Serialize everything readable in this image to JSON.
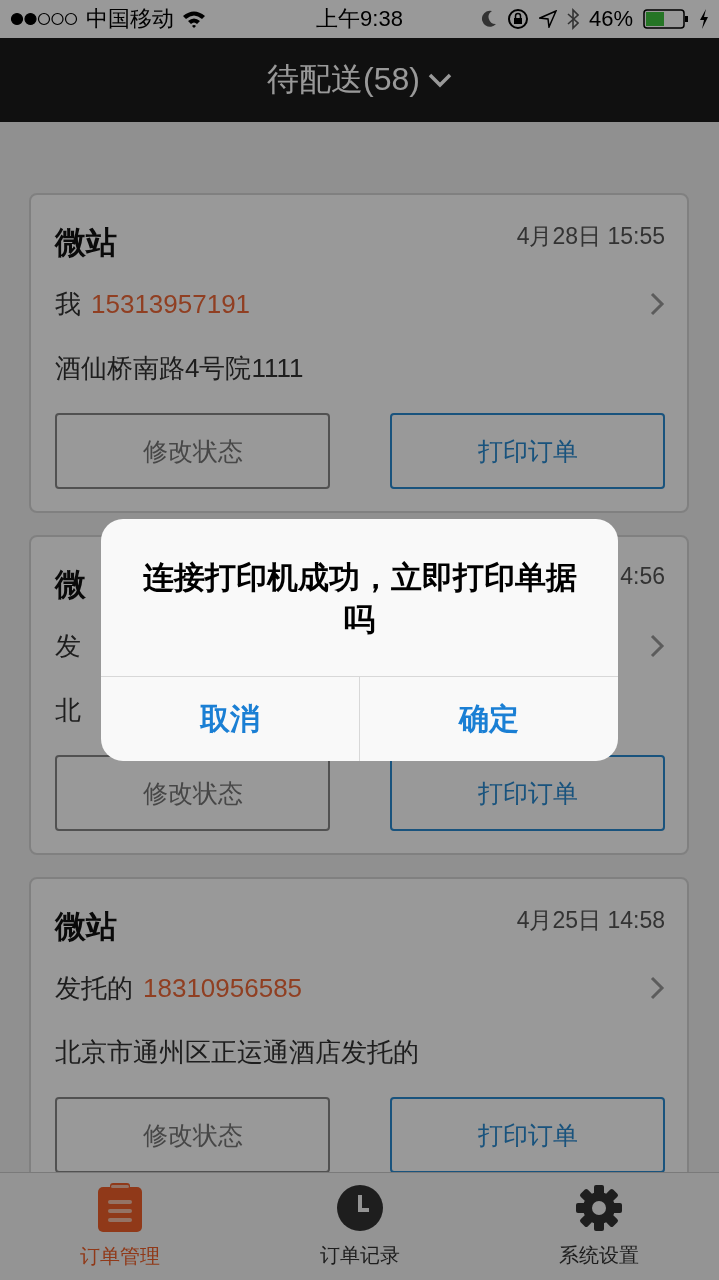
{
  "status_bar": {
    "carrier": "中国移动",
    "time": "上午9:38",
    "battery": "46%"
  },
  "nav_bar": {
    "title": "待配送(58)"
  },
  "orders": [
    {
      "source": "微站",
      "time": "4月28日 15:55",
      "contact": "我",
      "phone": "15313957191",
      "address": "酒仙桥南路4号院1111",
      "buttons": [
        "修改状态",
        "打印订单"
      ]
    },
    {
      "source": "微",
      "time": "4:56",
      "contact": "发",
      "address": "北",
      "buttons": [
        "修改状态",
        "打印订单"
      ]
    },
    {
      "source": "微站",
      "time": "4月25日 14:58",
      "contact": "发托的",
      "phone": "18310956585",
      "address": "北京市通州区正运通酒店发托的",
      "buttons": [
        "修改状态",
        "打印订单"
      ]
    }
  ],
  "dialog": {
    "message": "连接打印机成功，立即打印单据吗",
    "buttons": [
      "取消",
      "确定"
    ]
  },
  "tab_bar": [
    {
      "label": "订单管理",
      "selected": true
    },
    {
      "label": "订单记录",
      "selected": false
    },
    {
      "label": "系统设置",
      "selected": false
    }
  ]
}
